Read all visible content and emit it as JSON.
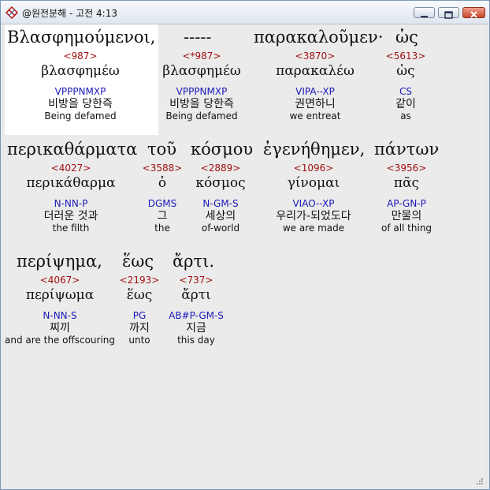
{
  "window": {
    "title": "@원전분해 - 고전 4:13"
  },
  "lines": [
    {
      "greek_text": [
        "Βλασφημούμενοι,",
        "-----",
        "παρακαλοῦμεν·",
        "ὡς"
      ],
      "words": [
        {
          "num": "<987>",
          "lemma": "βλασφημέω",
          "parsing": "VPPPNMXP",
          "korean": "비방을 당한즉",
          "english": "Being defamed"
        },
        {
          "num": "<*987>",
          "lemma": "βλασφημέω",
          "parsing": "VPPPNMXP",
          "korean": "비방을 당한즉",
          "english": "Being defamed"
        },
        {
          "num": "<3870>",
          "lemma": "παρακαλέω",
          "parsing": "VIPA--XP",
          "korean": "권면하니",
          "english": "we entreat"
        },
        {
          "num": "<5613>",
          "lemma": "ὡς",
          "parsing": "CS",
          "korean": "같이",
          "english": "as"
        }
      ]
    },
    {
      "greek_text": [
        "περικαθάρματα",
        "τοῦ",
        "κόσμου",
        "ἐγενήθημεν,",
        "πάντων"
      ],
      "words": [
        {
          "num": "<4027>",
          "lemma": "περικάθαρμα",
          "parsing": "N-NN-P",
          "korean": "더러운 것과",
          "english": "the filth"
        },
        {
          "num": "<3588>",
          "lemma": "ὁ",
          "parsing": "DGMS",
          "korean": "그",
          "english": "the"
        },
        {
          "num": "<2889>",
          "lemma": "κόσμος",
          "parsing": "N-GM-S",
          "korean": "세상의",
          "english": "of-world"
        },
        {
          "num": "<1096>",
          "lemma": "γίνομαι",
          "parsing": "VIAO--XP",
          "korean": "우리가-되었도다",
          "english": "we are made"
        },
        {
          "num": "<3956>",
          "lemma": "πᾶς",
          "parsing": "AP-GN-P",
          "korean": "만물의",
          "english": "of all thing"
        }
      ]
    },
    {
      "greek_text": [
        "περίψημα,",
        "ἕως",
        "ἄρτι."
      ],
      "words": [
        {
          "num": "<4067>",
          "lemma": "περίψωμα",
          "parsing": "N-NN-S",
          "korean": "찌끼",
          "english": "and are the offscouring"
        },
        {
          "num": "<2193>",
          "lemma": "ἕως",
          "parsing": "PG",
          "korean": "까지",
          "english": "unto"
        },
        {
          "num": "<737>",
          "lemma": "ἄρτι",
          "parsing": "AB#P-GM-S",
          "korean": "지금",
          "english": "this day"
        }
      ]
    }
  ]
}
